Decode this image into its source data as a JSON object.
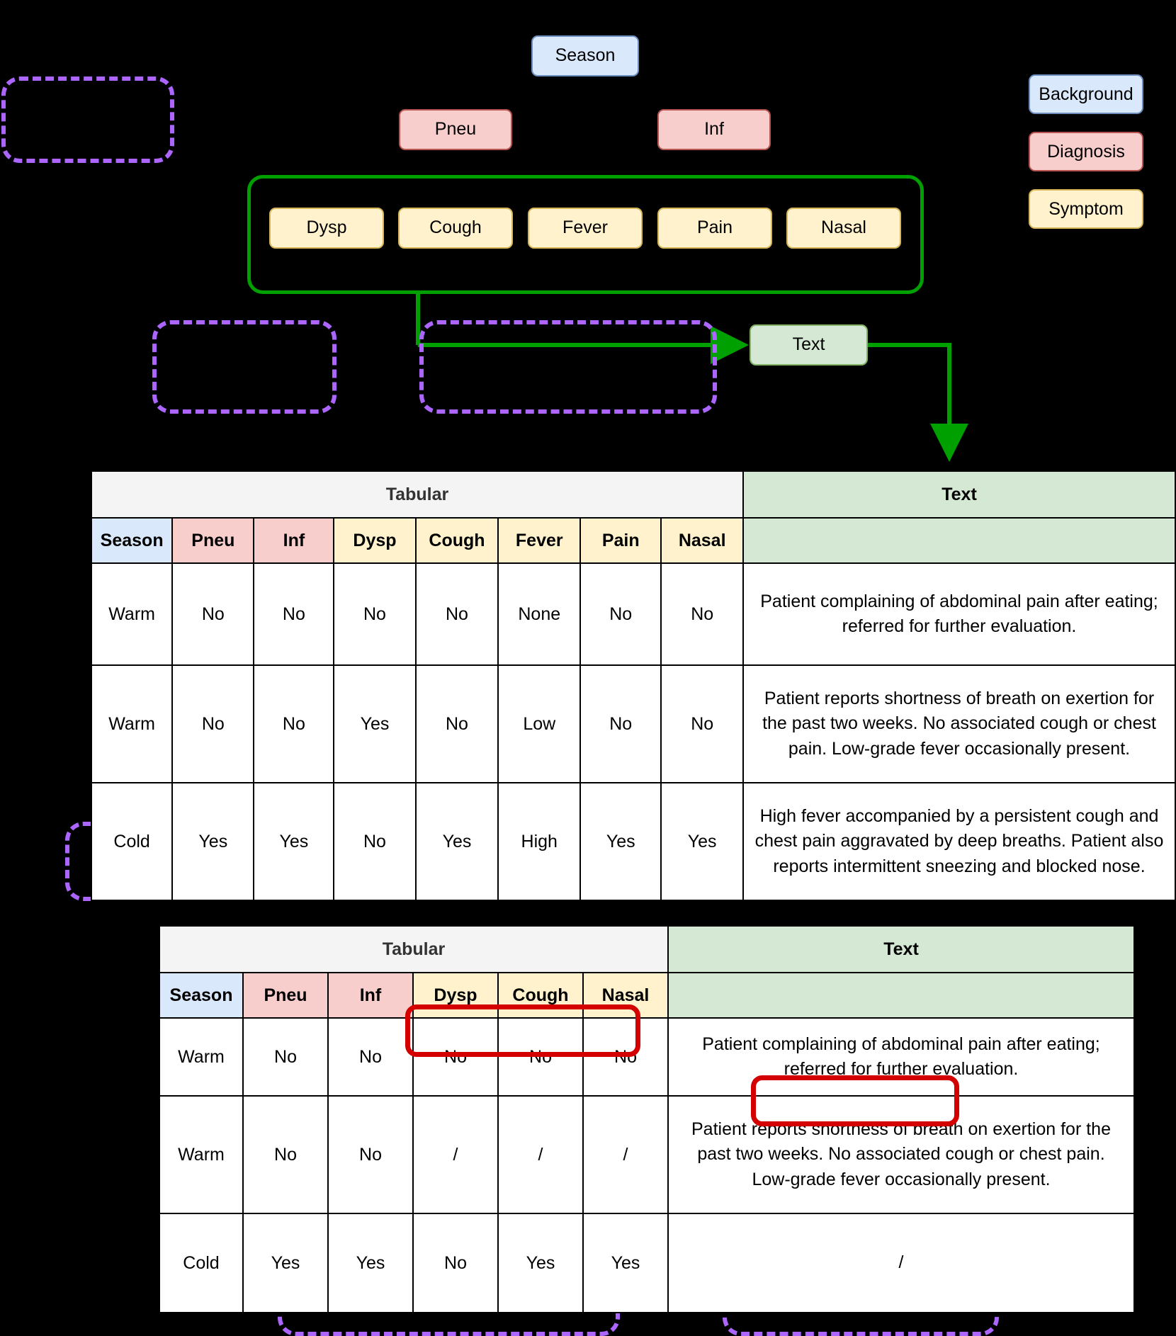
{
  "legend": {
    "items": [
      {
        "label": "Background",
        "color": "#dae8fc",
        "border": "#6c8ebf"
      },
      {
        "label": "Diagnosis",
        "color": "#f8cecc",
        "border": "#b85450"
      },
      {
        "label": "Symptom",
        "color": "#fff2cc",
        "border": "#d6b656"
      }
    ]
  },
  "graph": {
    "background_node": "Season",
    "diagnosis_nodes": [
      "Pneu",
      "Inf"
    ],
    "symptom_nodes": [
      "Dysp",
      "Cough",
      "Fever",
      "Pain",
      "Nasal"
    ],
    "text_node": "Text",
    "group_border_color": "#00a000",
    "placeholders": [
      "",
      "",
      "",
      "",
      "",
      "",
      ""
    ]
  },
  "table_top": {
    "section_tabular": "Tabular",
    "section_text": "Text",
    "columns": [
      "Season",
      "Pneu",
      "Inf",
      "Dysp",
      "Cough",
      "Fever",
      "Pain",
      "Nasal"
    ],
    "column_types": [
      "bg",
      "dx",
      "dx",
      "sym",
      "sym",
      "sym",
      "sym",
      "sym"
    ],
    "rows": [
      {
        "cells": [
          "Warm",
          "No",
          "No",
          "No",
          "No",
          "None",
          "No",
          "No"
        ],
        "text": "Patient complaining of abdominal pain after eating; referred for further evaluation."
      },
      {
        "cells": [
          "Warm",
          "No",
          "No",
          "Yes",
          "No",
          "Low",
          "No",
          "No"
        ],
        "text": "Patient reports shortness of breath on exertion for the past two weeks. No associated cough or chest pain. Low-grade fever occasionally present."
      },
      {
        "cells": [
          "Cold",
          "Yes",
          "Yes",
          "No",
          "Yes",
          "High",
          "Yes",
          "Yes"
        ],
        "text": "High fever accompanied by a persistent cough and chest pain aggravated by deep breaths. Patient also reports intermittent sneezing and blocked nose."
      }
    ]
  },
  "table_bottom": {
    "section_tabular": "Tabular",
    "section_text": "Text",
    "columns": [
      "Season",
      "Pneu",
      "Inf",
      "Dysp",
      "Cough",
      "Nasal"
    ],
    "column_types": [
      "bg",
      "dx",
      "dx",
      "sym",
      "sym",
      "sym"
    ],
    "rows": [
      {
        "cells": [
          "Warm",
          "No",
          "No",
          "No",
          "No",
          "No"
        ],
        "text": "Patient complaining of abdominal pain after eating; referred for further evaluation."
      },
      {
        "cells": [
          "Warm",
          "No",
          "No",
          "/",
          "/",
          "/"
        ],
        "text": "Patient reports shortness of breath on exertion for the past two weeks. No associated cough or chest pain. Low-grade fever occasionally present."
      },
      {
        "cells": [
          "Cold",
          "Yes",
          "Yes",
          "No",
          "Yes",
          "Yes"
        ],
        "text": "/"
      }
    ]
  },
  "annotations": {
    "cross_mark": "✕",
    "accent_red": "#d40000",
    "accent_green": "#00a000",
    "accent_purple": "#ac66ff"
  }
}
